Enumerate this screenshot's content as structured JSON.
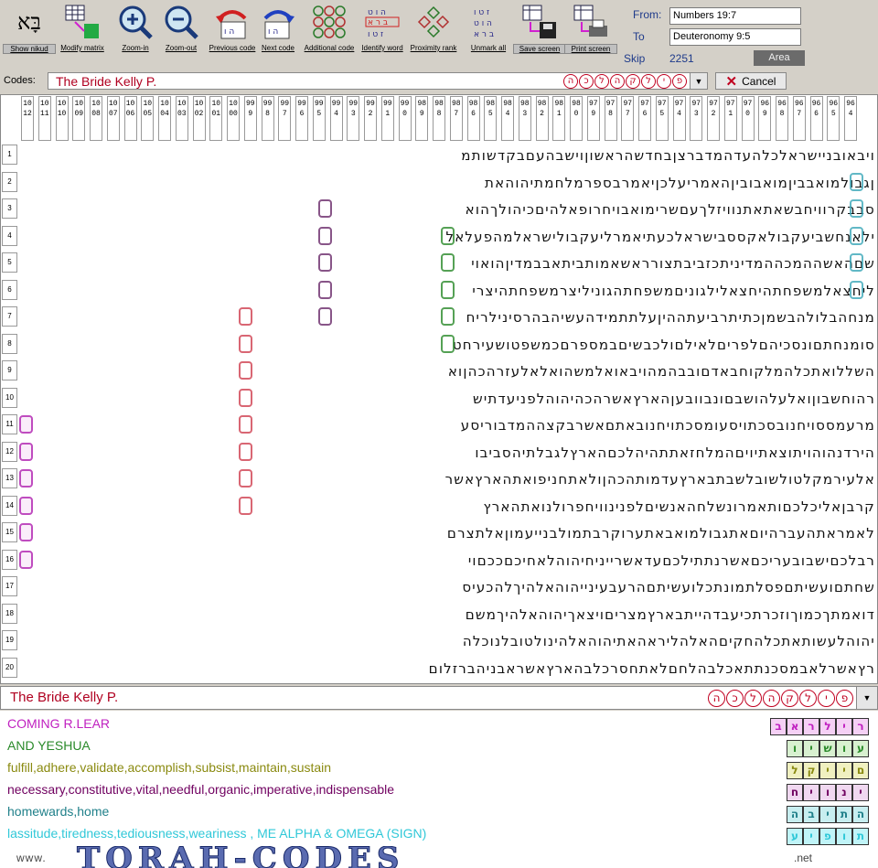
{
  "toolbar": {
    "buttons": [
      {
        "id": "show-nikud",
        "label": "Show nikud",
        "icon": "hebrew-bet-alef-icon"
      },
      {
        "id": "modify-matrix",
        "label": "Modify matrix",
        "icon": "grid-arrow-icon"
      },
      {
        "id": "zoom-in",
        "label": "Zoom-in",
        "icon": "zoom-in-icon"
      },
      {
        "id": "zoom-out",
        "label": "Zoom-out",
        "icon": "zoom-out-icon"
      },
      {
        "id": "previous-code",
        "label": "Previous code",
        "icon": "previous-arrow-icon"
      },
      {
        "id": "next-code",
        "label": "Next code",
        "icon": "next-arrow-icon"
      },
      {
        "id": "additional-code",
        "label": "Additional code",
        "icon": "additional-code-icon"
      },
      {
        "id": "identify-word",
        "label": "Identify word",
        "icon": "identify-word-icon"
      },
      {
        "id": "proximity-rank",
        "label": "Proximity rank",
        "icon": "proximity-rank-icon"
      },
      {
        "id": "unmark-all",
        "label": "Unmark all",
        "icon": "unmark-all-icon"
      },
      {
        "id": "save-screen",
        "label": "Save screen",
        "icon": "save-disk-icon"
      },
      {
        "id": "print-screen",
        "label": "Print screen",
        "icon": "printer-icon"
      }
    ],
    "nikud_glyph": "בָּא",
    "icon_letters": [
      "ו",
      "ה",
      "ט",
      "ז"
    ]
  },
  "range": {
    "from_label": "From:",
    "from_value": "Numbers 19:7",
    "to_label": "To",
    "to_value": "Deuteronomy 9:5",
    "skip_label": "Skip",
    "skip_value": "2251",
    "area_label": "Area"
  },
  "codes": {
    "label": "Codes:",
    "value": "The Bride Kelly P.",
    "circled_letters": [
      "ה",
      "כ",
      "ל",
      "ה",
      "ק",
      "ל",
      "י",
      "פ"
    ],
    "cancel_label": "Cancel"
  },
  "column_numbers": [
    "1012",
    "1011",
    "1010",
    "1009",
    "1008",
    "1007",
    "1006",
    "1005",
    "1004",
    "1003",
    "1002",
    "1001",
    "1000",
    "999",
    "998",
    "997",
    "996",
    "995",
    "994",
    "993",
    "992",
    "991",
    "990",
    "989",
    "988",
    "987",
    "986",
    "985",
    "984",
    "983",
    "982",
    "981",
    "980",
    "979",
    "978",
    "977",
    "976",
    "975",
    "974",
    "973",
    "972",
    "971",
    "970",
    "969",
    "968",
    "967",
    "966",
    "965",
    "964"
  ],
  "row_numbers": [
    "1",
    "2",
    "3",
    "4",
    "5",
    "6",
    "7",
    "8",
    "9",
    "10",
    "11",
    "12",
    "13",
    "14",
    "15",
    "16",
    "17",
    "18",
    "19",
    "20"
  ],
  "matrix_rows": [
    "ויבאובניישראלכלהעדהמדברצןבחדשהראשוןוישבהעםבקדשותמ",
    "ןגבולמואבביןמואבוביןהאמריעלכןיאמרבספרמלחמתיהוהאת",
    "סבבקרוויחבשאתאתנוויזלךעםשרימואבויחרופאלהיםכיהולךהוא",
    "ילאנחשביעקבולאקססבישראלכעתיאמרליעקבולישראלמהפעלאל",
    "שםהאשההמכההמדיניתכזביבתצורראשאמותביתאבבמדיןהואוי",
    "ליחצאלמשפחתהיחצאלילגוניםמשפחתהגוניליצרמשפחתהיצרי",
    "מנחהבלולהבשמןכתיתרביעתההיןעלתתמידהעשיהבהרסינילריח",
    "סומנחתםונסכיהםלפריםלאילםולכבשיםבמספרםכמשפטושעירחט",
    "השללואתכלהמלקוחבאדםובבהמהויבאואלמשהואלאלעזרהכהןוא",
    "רהוחשבוןואלעלהושבםונבוובעןהארץאשרהכהיהוהלפניעדתיש",
    "מרעמססויחנובסכתויסעומסכתויחנובאתםאשרבקצההמדבוריסע",
    "הירדנהוהויתוצאתיויםהמלחזאתתהיהלכםהארץלגבלתיהסביבו",
    "אלעירמקלטולשובלשבתבארץעדמותהכהןולאתחניפואתהארץאשר",
    "קרבןאליכלכםותאמרונשלחהאנשיםלפנינוויחפרולנואתהארץ",
    "לאמראתהעברהיוםאתגבולמואבאתערוקרבתמולבנייעמוןאלתצרם",
    "רבלכםישבובעריכםאשרנתתילכםעדאשרייניחיהוהלאחיכםככםוי",
    "שחתםועשיתםפסלתמונתכלועשיתםהרעבעינייהוהאלהיךלהכעיס",
    "דואמתךכמוךוזכרתכיעבדהייתבארץמצריםויצאךיהוהאלהיךמשם",
    "יהוהלעשותאתכלהחקיםהאלהליראהאתיהוהאלהינולטובלנוכלה",
    "רץאשרלאבמסכנתתאכלבהלחםלאתחסרכלבהארץאשראבניהברזלום"
  ],
  "result": {
    "value": "The Bride Kelly P.",
    "circled_letters": [
      "ה",
      "כ",
      "ל",
      "ה",
      "ק",
      "ל",
      "י",
      "פ"
    ]
  },
  "translations": [
    {
      "text": "COMING R.LEAR",
      "color": "#c020c0",
      "letters": [
        "ב",
        "א",
        "ר",
        "ל",
        "י",
        "ר"
      ],
      "boxcolor": "#f5d0f5"
    },
    {
      "text": "AND YESHUA",
      "color": "#2a8a2a",
      "letters": [
        "ו",
        "י",
        "ש",
        "ו",
        "ע"
      ],
      "boxcolor": "#d8f0d0"
    },
    {
      "text": "fulfill,adhere,validate,accomplish,subsist,maintain,sustain",
      "color": "#8a8a10",
      "letters": [
        "ל",
        "ק",
        "י",
        "י",
        "ם"
      ],
      "boxcolor": "#f0f0c0"
    },
    {
      "text": "necessary,constitutive,vital,needful,organic,imperative,indispensable",
      "color": "#700060",
      "letters": [
        "ח",
        "י",
        "ו",
        "נ",
        "י"
      ],
      "boxcolor": "#f0d8f0"
    },
    {
      "text": "homewards,home",
      "color": "#20808a",
      "letters": [
        "ה",
        "ב",
        "י",
        "ת",
        "ה"
      ],
      "boxcolor": "#c8eef0"
    },
    {
      "text": "lassitude,tiredness,tediousness,weariness , ME ALPHA & OMEGA (SIGN)",
      "color": "#30c8d8",
      "letters": [
        "ע",
        "י",
        "פ",
        "ו",
        "ת"
      ],
      "boxcolor": "#c0f4f8"
    }
  ],
  "watermark": {
    "left": "www.",
    "main": "TORAH-CODES",
    "right": ".net"
  },
  "colors": {
    "accent_red": "#c00020",
    "label_blue": "#1e3a8a"
  }
}
